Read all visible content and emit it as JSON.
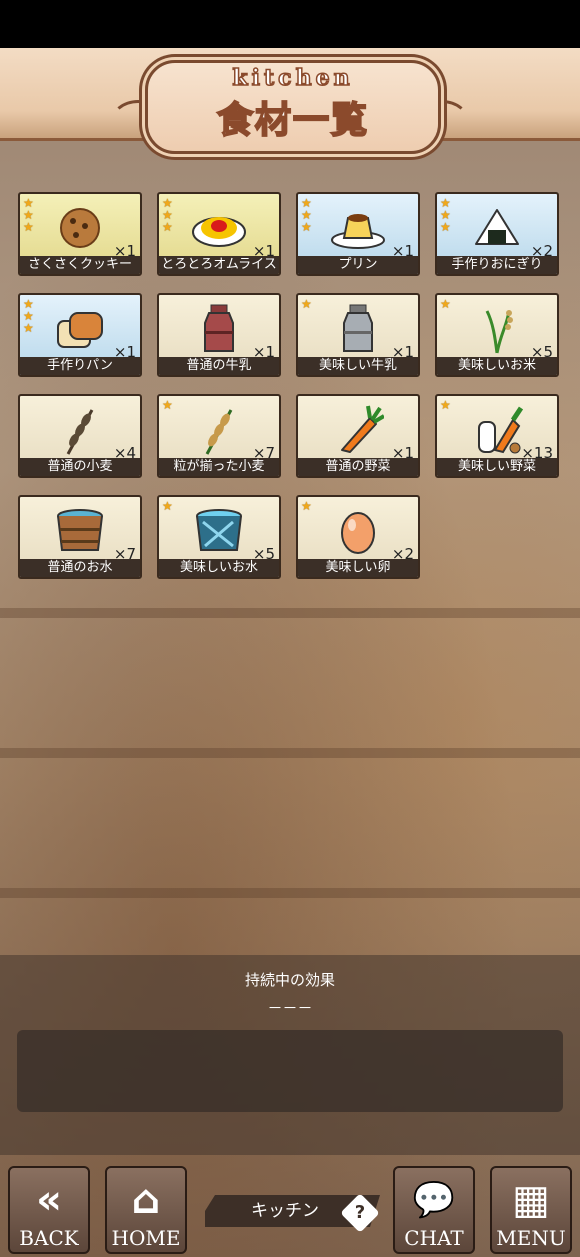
{
  "header": {
    "title_en": "kitchen",
    "title_jp": "食材一覧"
  },
  "items": [
    {
      "label": "さくさくクッキー",
      "qty": "×1",
      "stars": 3,
      "bg": "gold",
      "icon": "cookie-icon"
    },
    {
      "label": "とろとろオムライス",
      "qty": "×1",
      "stars": 3,
      "bg": "gold",
      "icon": "omurice-icon"
    },
    {
      "label": "プリン",
      "qty": "×1",
      "stars": 3,
      "bg": "blue",
      "icon": "pudding-icon"
    },
    {
      "label": "手作りおにぎり",
      "qty": "×2",
      "stars": 3,
      "bg": "blue",
      "icon": "onigiri-icon"
    },
    {
      "label": "手作りパン",
      "qty": "×1",
      "stars": 3,
      "bg": "blue",
      "icon": "bread-icon"
    },
    {
      "label": "普通の牛乳",
      "qty": "×1",
      "stars": 0,
      "bg": "plain",
      "icon": "milk-can-red-icon"
    },
    {
      "label": "美味しい牛乳",
      "qty": "×1",
      "stars": 1,
      "bg": "plain",
      "icon": "milk-can-silver-icon"
    },
    {
      "label": "美味しいお米",
      "qty": "×5",
      "stars": 1,
      "bg": "plain",
      "icon": "rice-plant-icon"
    },
    {
      "label": "普通の小麦",
      "qty": "×4",
      "stars": 0,
      "bg": "plain",
      "icon": "wheat-icon"
    },
    {
      "label": "粒が揃った小麦",
      "qty": "×7",
      "stars": 1,
      "bg": "plain",
      "icon": "wheat-good-icon"
    },
    {
      "label": "普通の野菜",
      "qty": "×1",
      "stars": 0,
      "bg": "plain",
      "icon": "carrot-icon"
    },
    {
      "label": "美味しい野菜",
      "qty": "×13",
      "stars": 1,
      "bg": "plain",
      "icon": "vegetables-icon"
    },
    {
      "label": "普通のお水",
      "qty": "×7",
      "stars": 0,
      "bg": "plain",
      "icon": "water-bucket-icon"
    },
    {
      "label": "美味しいお水",
      "qty": "×5",
      "stars": 1,
      "bg": "plain",
      "icon": "water-bucket-blue-icon"
    },
    {
      "label": "美味しい卵",
      "qty": "×2",
      "stars": 1,
      "bg": "plain",
      "icon": "egg-icon"
    }
  ],
  "effect": {
    "title": "持続中の効果",
    "value": "－－－"
  },
  "nav": {
    "back": "BACK",
    "home": "HOME",
    "location": "キッチン",
    "help": "?",
    "chat": "CHAT",
    "menu": "MENU"
  }
}
